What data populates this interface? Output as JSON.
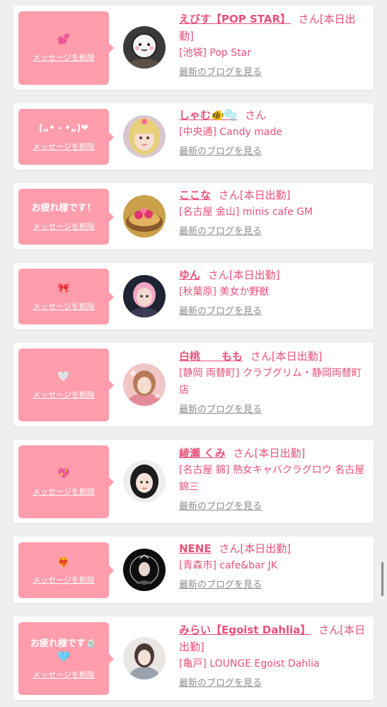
{
  "delete_label": "メッセージを削除",
  "blog_label": "最新のブログを見る",
  "san_label": "さん",
  "colors": {
    "accent": "#e8517a",
    "bubble": "#ff9dac",
    "background": "#efefef"
  },
  "messages": [
    {
      "bubble_text": "",
      "bubble_emoji": "💕",
      "name": "えびす【POP STAR】",
      "status": "[本日出勤]",
      "shop": "[池袋] Pop Star"
    },
    {
      "bubble_text": "(„• ֊ •„)❤",
      "bubble_emoji": "",
      "name": "しゃむ🐠🫧",
      "status": "",
      "shop": "[中央通] Candy made"
    },
    {
      "bubble_text": "お疲れ様です！",
      "bubble_emoji": "",
      "name": "ここな",
      "status": "[本日出勤]",
      "shop": "[名古屋 金山] minis cafe GM"
    },
    {
      "bubble_text": "",
      "bubble_emoji": "🎀",
      "name": "ゆん",
      "status": "[本日出勤]",
      "shop": "[秋葉原] 美女か野獣"
    },
    {
      "bubble_text": "",
      "bubble_emoji": "🤍",
      "name": "白桃　　もも",
      "status": "[本日出勤]",
      "shop": "[静岡 両替町] クラブグリム・静岡両替町店"
    },
    {
      "bubble_text": "",
      "bubble_emoji": "💖",
      "name": "綾瀬 くみ",
      "status": "[本日出勤]",
      "shop": "[名古屋 錦] 熟女キャバクラグロウ 名古屋錦三"
    },
    {
      "bubble_text": "",
      "bubble_emoji": "❤️‍🔥",
      "name": "NENE",
      "status": "[本日出勤]",
      "shop": "[青森市] cafe&bar JK"
    },
    {
      "bubble_text": "お疲れ様です🍵",
      "bubble_emoji": "🩵",
      "name": "みらい【Egoist Dahlia】",
      "status": "[本日出勤]",
      "shop": "[亀戸] LOUNGE Egoist Dahlia"
    }
  ]
}
